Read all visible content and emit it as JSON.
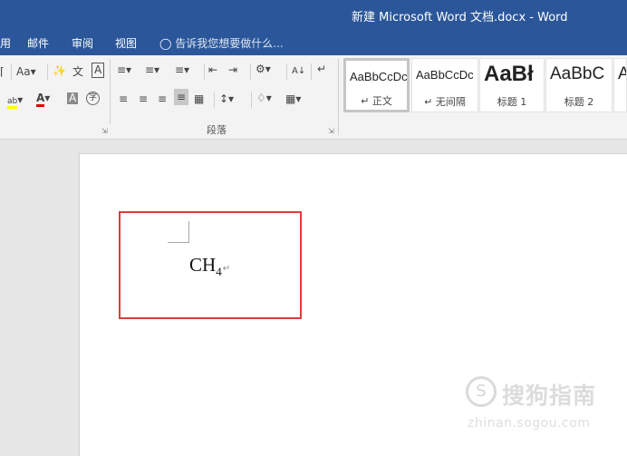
{
  "window": {
    "title": "新建 Microsoft Word 文档.docx - Word"
  },
  "tabs": {
    "partial": "用",
    "mailings": "邮件",
    "review": "审阅",
    "view": "视图",
    "tellme": "告诉我您想要做什么..."
  },
  "ribbon": {
    "font": {
      "size_grow": "Aa",
      "highlight_label": "ab",
      "font_color_label": "A",
      "shading_label": "A",
      "char_border_label": "A",
      "enclose_label": "字",
      "phonetic_label": "文"
    },
    "paragraph": {
      "group_label": "段落",
      "sort_label": "A↓"
    },
    "styles": [
      {
        "sample": "AaBbCcDc",
        "name": "↵ 正文",
        "selected": true
      },
      {
        "sample": "AaBbCcDc",
        "name": "↵ 无间隔",
        "selected": false
      },
      {
        "sample": "AaBł",
        "name": "标题 1",
        "selected": false
      },
      {
        "sample": "AaBbC",
        "name": "标题 2",
        "selected": false
      },
      {
        "sample": "A",
        "name": "",
        "selected": false
      }
    ]
  },
  "document": {
    "formula_main": "CH",
    "formula_sub": "4",
    "paragraph_mark": "↵"
  },
  "watermark": {
    "brand": "搜狗指南",
    "logo_char": "S",
    "url": "zhinan.sogou.com"
  },
  "colors": {
    "accent": "#2b579a",
    "highlight_box": "#e23a3a",
    "font_color_red": "#e00000",
    "highlight_yellow": "#ffff00"
  }
}
